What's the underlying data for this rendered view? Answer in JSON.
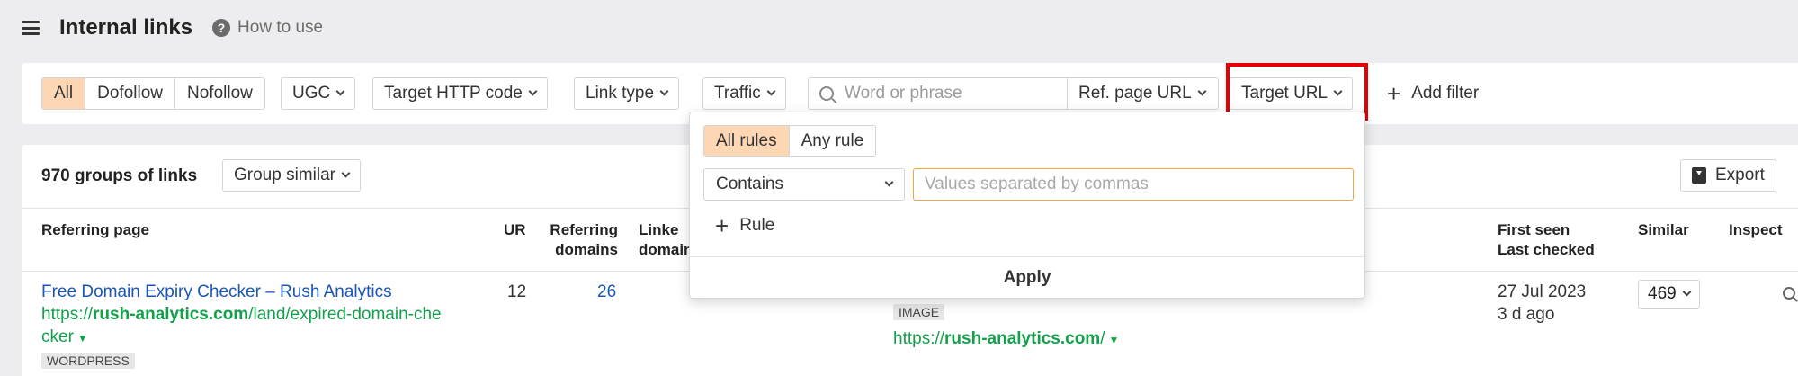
{
  "header": {
    "title": "Internal links",
    "help_label": "How to use"
  },
  "filters": {
    "link_type_segments": [
      "All",
      "Dofollow",
      "Nofollow"
    ],
    "ugc_label": "UGC",
    "target_http_code_label": "Target HTTP code",
    "link_type_label": "Link type",
    "traffic_label": "Traffic",
    "search_placeholder": "Word or phrase",
    "ref_page_url_label": "Ref. page URL",
    "target_url_label": "Target URL",
    "add_filter_label": "Add filter"
  },
  "dropdown": {
    "rule_modes": [
      "All rules",
      "Any rule"
    ],
    "operator_value": "Contains",
    "values_placeholder": "Values separated by commas",
    "add_rule_label": "Rule",
    "apply_label": "Apply"
  },
  "results": {
    "groups_count": "970 groups of links",
    "group_similar_label": "Group similar",
    "export_label": "Export"
  },
  "table": {
    "headers": {
      "referring_page": "Referring page",
      "ur": "UR",
      "referring_domains": [
        "Referring",
        "domains"
      ],
      "linked_domains": [
        "Linke",
        "domain"
      ],
      "first_seen": [
        "First seen",
        "Last checked"
      ],
      "similar": "Similar",
      "inspect": "Inspect"
    },
    "rows": [
      {
        "title": "Free Domain Expiry Checker – Rush Analytics",
        "url_prefix": "https://",
        "url_domain": "rush-analytics.com",
        "url_path_line1": "/land/expired-domain-che",
        "url_path_line2": "cker",
        "platform_badge": "WORDPRESS",
        "ur": "12",
        "referring_domains": "26",
        "target_badge": "IMAGE",
        "target_prefix": "https://",
        "target_domain": "rush-analytics.com",
        "target_path": "/",
        "first_seen": "27 Jul 2023",
        "last_checked": "3 d ago",
        "similar": "469"
      }
    ]
  }
}
